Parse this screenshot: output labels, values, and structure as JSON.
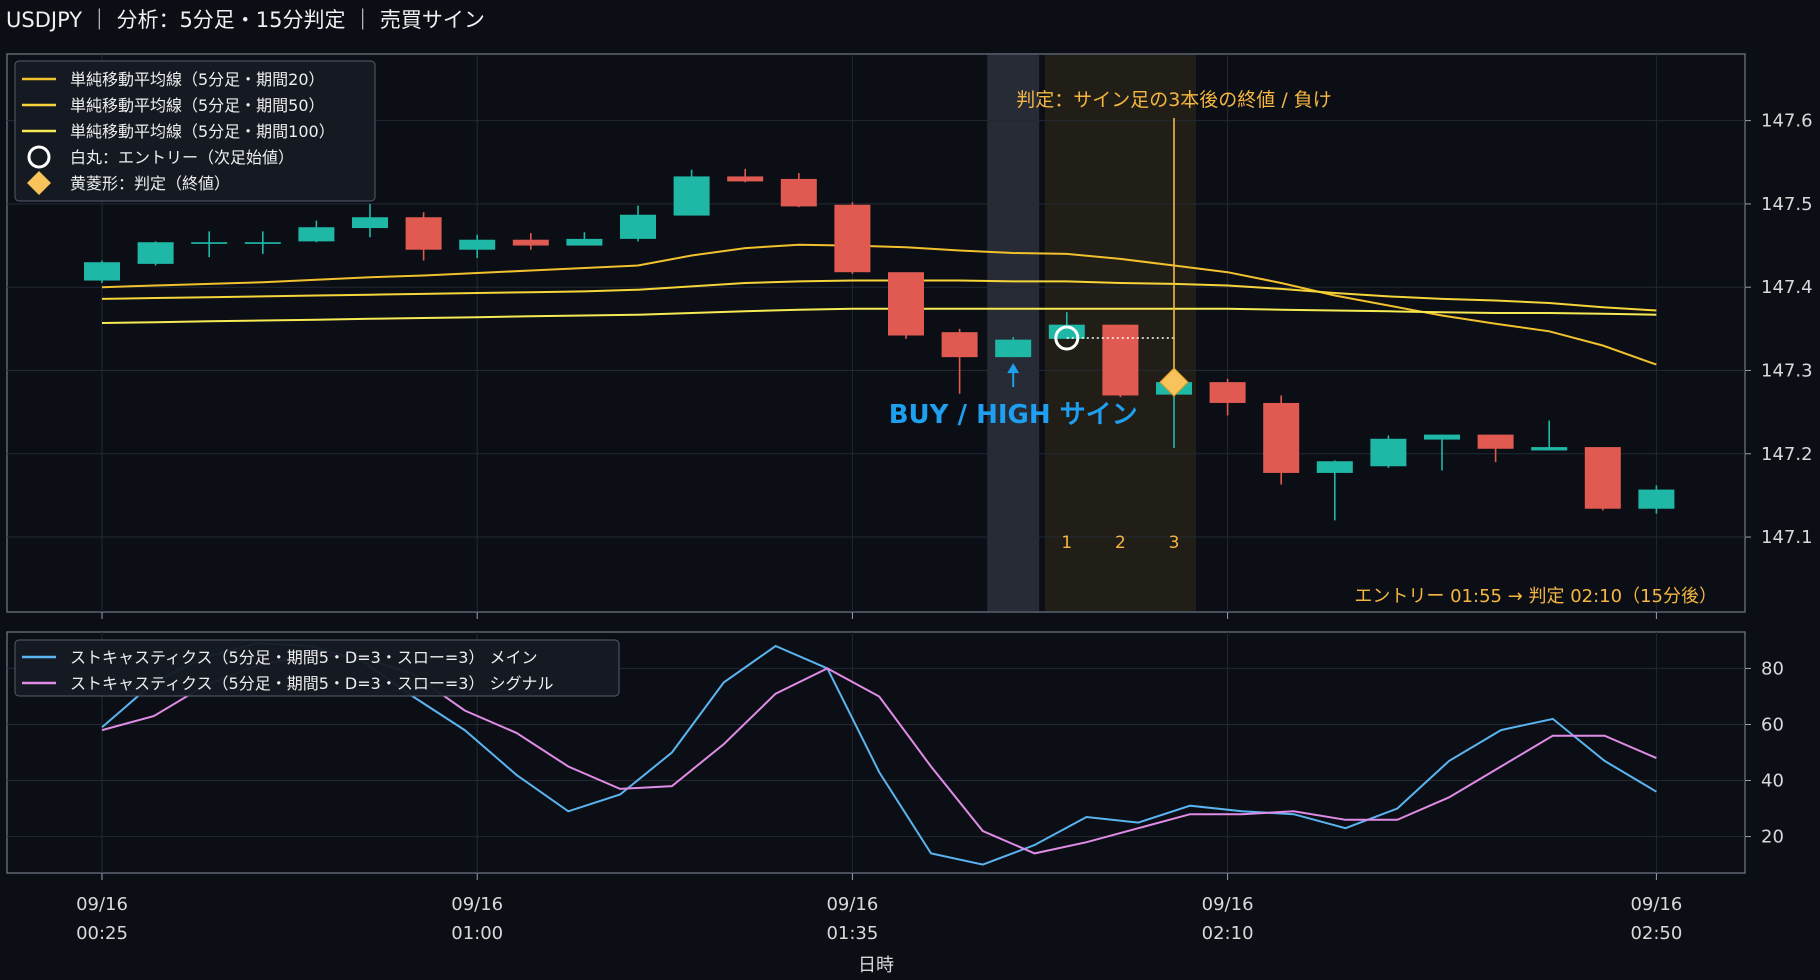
{
  "title": "USDJPY ｜ 分析：5分足・15分判定 ｜ 売買サイン",
  "colors": {
    "background": "#0b0e14",
    "up": "#1fb8a6",
    "down": "#e05a52",
    "sma20": "#f2c12e",
    "sma50": "#f7d53a",
    "sma100": "#f7ea54",
    "stoch_main": "#5ab4f0",
    "stoch_signal": "#e08ce6",
    "buy_label": "#1e9ff0",
    "judge": "#f5b642"
  },
  "chart_data": [
    {
      "type": "candlestick",
      "title": "USDJPY ｜ 分析：5分足・15分判定 ｜ 売買サイン",
      "ylim": [
        147.01,
        147.68
      ],
      "yticks": [
        147.1,
        147.2,
        147.3,
        147.4,
        147.5,
        147.6
      ],
      "candles": [
        {
          "o": 147.408,
          "h": 147.432,
          "l": 147.405,
          "c": 147.43
        },
        {
          "o": 147.428,
          "h": 147.455,
          "l": 147.426,
          "c": 147.454
        },
        {
          "o": 147.452,
          "h": 147.467,
          "l": 147.436,
          "c": 147.454
        },
        {
          "o": 147.452,
          "h": 147.467,
          "l": 147.44,
          "c": 147.454
        },
        {
          "o": 147.455,
          "h": 147.48,
          "l": 147.454,
          "c": 147.472
        },
        {
          "o": 147.471,
          "h": 147.5,
          "l": 147.46,
          "c": 147.484
        },
        {
          "o": 147.484,
          "h": 147.49,
          "l": 147.432,
          "c": 147.445
        },
        {
          "o": 147.445,
          "h": 147.463,
          "l": 147.435,
          "c": 147.457
        },
        {
          "o": 147.457,
          "h": 147.465,
          "l": 147.445,
          "c": 147.45
        },
        {
          "o": 147.45,
          "h": 147.466,
          "l": 147.45,
          "c": 147.458
        },
        {
          "o": 147.458,
          "h": 147.498,
          "l": 147.455,
          "c": 147.487
        },
        {
          "o": 147.486,
          "h": 147.541,
          "l": 147.486,
          "c": 147.533
        },
        {
          "o": 147.533,
          "h": 147.542,
          "l": 147.526,
          "c": 147.527
        },
        {
          "o": 147.53,
          "h": 147.537,
          "l": 147.496,
          "c": 147.497
        },
        {
          "o": 147.499,
          "h": 147.502,
          "l": 147.416,
          "c": 147.418
        },
        {
          "o": 147.418,
          "h": 147.418,
          "l": 147.338,
          "c": 147.342
        },
        {
          "o": 147.346,
          "h": 147.35,
          "l": 147.272,
          "c": 147.316
        },
        {
          "o": 147.316,
          "h": 147.34,
          "l": 147.316,
          "c": 147.337
        },
        {
          "o": 147.338,
          "h": 147.37,
          "l": 147.338,
          "c": 147.355
        },
        {
          "o": 147.355,
          "h": 147.355,
          "l": 147.268,
          "c": 147.27
        },
        {
          "o": 147.271,
          "h": 147.301,
          "l": 147.207,
          "c": 147.286
        },
        {
          "o": 147.286,
          "h": 147.29,
          "l": 147.246,
          "c": 147.261
        },
        {
          "o": 147.261,
          "h": 147.27,
          "l": 147.163,
          "c": 147.177
        },
        {
          "o": 147.177,
          "h": 147.192,
          "l": 147.12,
          "c": 147.191
        },
        {
          "o": 147.185,
          "h": 147.222,
          "l": 147.183,
          "c": 147.218
        },
        {
          "o": 147.217,
          "h": 147.223,
          "l": 147.18,
          "c": 147.223
        },
        {
          "o": 147.223,
          "h": 147.223,
          "l": 147.19,
          "c": 147.206
        },
        {
          "o": 147.204,
          "h": 147.24,
          "l": 147.204,
          "c": 147.208
        },
        {
          "o": 147.208,
          "h": 147.208,
          "l": 147.132,
          "c": 147.134
        },
        {
          "o": 147.134,
          "h": 147.162,
          "l": 147.128,
          "c": 147.157
        }
      ],
      "series": [
        {
          "name": "単純移動平均線（5分足・期間20）",
          "values": [
            147.4,
            147.402,
            147.404,
            147.406,
            147.409,
            147.412,
            147.414,
            147.417,
            147.42,
            147.423,
            147.426,
            147.438,
            147.447,
            147.451,
            147.45,
            147.448,
            147.444,
            147.441,
            147.44,
            147.434,
            147.426,
            147.418,
            147.405,
            147.39,
            147.378,
            147.366,
            147.356,
            147.347,
            147.33,
            147.307
          ]
        },
        {
          "name": "単純移動平均線（5分足・期間50）",
          "values": [
            147.386,
            147.387,
            147.388,
            147.389,
            147.39,
            147.391,
            147.392,
            147.393,
            147.394,
            147.395,
            147.397,
            147.401,
            147.405,
            147.407,
            147.408,
            147.408,
            147.408,
            147.407,
            147.407,
            147.405,
            147.404,
            147.402,
            147.398,
            147.393,
            147.389,
            147.386,
            147.384,
            147.381,
            147.376,
            147.372
          ]
        },
        {
          "name": "単純移動平均線（5分足・期間100）",
          "values": [
            147.357,
            147.358,
            147.359,
            147.36,
            147.361,
            147.362,
            147.363,
            147.364,
            147.365,
            147.366,
            147.367,
            147.369,
            147.371,
            147.373,
            147.374,
            147.374,
            147.374,
            147.374,
            147.374,
            147.374,
            147.374,
            147.374,
            147.373,
            147.372,
            147.371,
            147.37,
            147.369,
            147.369,
            147.368,
            147.367
          ]
        }
      ],
      "legend": [
        {
          "label": "単純移動平均線（5分足・期間20）",
          "kind": "line",
          "color": "#f2c12e"
        },
        {
          "label": "単純移動平均線（5分足・期間50）",
          "kind": "line",
          "color": "#f7d53a"
        },
        {
          "label": "単純移動平均線（5分足・期間100）",
          "kind": "line",
          "color": "#f7ea54"
        },
        {
          "label": "白丸：エントリー（次足始値）",
          "kind": "circle",
          "color": "#ffffff"
        },
        {
          "label": "黄菱形：判定（終値）",
          "kind": "diamond",
          "color": "#f5b642"
        }
      ],
      "legend_position": "top-left",
      "signal": {
        "index": 17,
        "label": "BUY / HIGH サイン"
      },
      "entry": {
        "index": 18,
        "price": 147.339
      },
      "judge": {
        "index": 20,
        "price": 147.286,
        "label": "判定：サイン足の3本後の終値 / 負け",
        "counts": [
          "1",
          "2",
          "3"
        ]
      },
      "footer_note": "エントリー 01:55 → 判定 02:10（15分後）",
      "grid": true
    },
    {
      "type": "line",
      "ylim": [
        7,
        93
      ],
      "yticks": [
        20,
        40,
        60,
        80
      ],
      "series": [
        {
          "name": "ストキャスティクス（5分足・期間5・D=3・スロー=3） メイン",
          "values": [
            59,
            75,
            84,
            89,
            88,
            83,
            70,
            58,
            42,
            29,
            35,
            50,
            75,
            88,
            80,
            43,
            14,
            10,
            17,
            27,
            25,
            31,
            29,
            28,
            23,
            30,
            47,
            58,
            62,
            47,
            36
          ]
        },
        {
          "name": "ストキャスティクス（5分足・期間5・D=3・スロー=3） シグナル",
          "values": [
            58,
            63,
            74,
            81,
            85,
            84,
            78,
            65,
            57,
            45,
            37,
            38,
            53,
            71,
            80,
            70,
            45,
            22,
            14,
            18,
            23,
            28,
            28,
            29,
            26,
            26,
            34,
            45,
            56,
            56,
            48
          ]
        }
      ],
      "legend_position": "top-left",
      "grid": true
    }
  ],
  "xaxis": {
    "label": "日時",
    "ticks": [
      {
        "index": 0,
        "date": "09/16",
        "time": "00:25"
      },
      {
        "index": 7,
        "date": "09/16",
        "time": "01:00"
      },
      {
        "index": 14,
        "date": "09/16",
        "time": "01:35"
      },
      {
        "index": 21,
        "date": "09/16",
        "time": "02:10"
      },
      {
        "index": 29,
        "date": "09/16",
        "time": "02:50"
      }
    ]
  }
}
